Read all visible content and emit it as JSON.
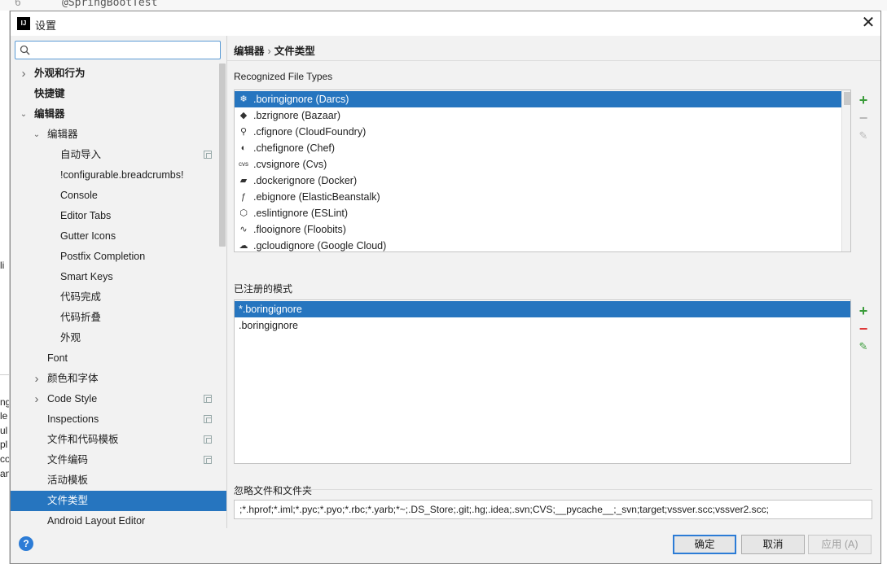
{
  "background_editor": {
    "line_number": "6",
    "code_line": "@SpringBootTest",
    "left_fragments": [
      "li",
      "ng",
      "le",
      "ul",
      "pl",
      "co",
      "an"
    ]
  },
  "window": {
    "title": "设置",
    "app_icon": "IJ"
  },
  "search": {
    "placeholder": "",
    "value": ""
  },
  "tree": [
    {
      "label": "外观和行为",
      "level": 0,
      "expand": "collapsed",
      "bold": true,
      "copy": false,
      "selected": false
    },
    {
      "label": "快捷键",
      "level": 0,
      "expand": "none",
      "bold": true,
      "copy": false,
      "selected": false
    },
    {
      "label": "编辑器",
      "level": 0,
      "expand": "expanded",
      "bold": true,
      "copy": false,
      "selected": false
    },
    {
      "label": "编辑器",
      "level": 1,
      "expand": "expanded",
      "bold": false,
      "copy": false,
      "selected": false
    },
    {
      "label": "自动导入",
      "level": 2,
      "expand": "none",
      "bold": false,
      "copy": true,
      "selected": false
    },
    {
      "label": "!configurable.breadcrumbs!",
      "level": 2,
      "expand": "none",
      "bold": false,
      "copy": false,
      "selected": false
    },
    {
      "label": "Console",
      "level": 2,
      "expand": "none",
      "bold": false,
      "copy": false,
      "selected": false
    },
    {
      "label": "Editor Tabs",
      "level": 2,
      "expand": "none",
      "bold": false,
      "copy": false,
      "selected": false
    },
    {
      "label": "Gutter Icons",
      "level": 2,
      "expand": "none",
      "bold": false,
      "copy": false,
      "selected": false
    },
    {
      "label": "Postfix Completion",
      "level": 2,
      "expand": "none",
      "bold": false,
      "copy": false,
      "selected": false
    },
    {
      "label": "Smart Keys",
      "level": 2,
      "expand": "none",
      "bold": false,
      "copy": false,
      "selected": false
    },
    {
      "label": "代码完成",
      "level": 2,
      "expand": "none",
      "bold": false,
      "copy": false,
      "selected": false
    },
    {
      "label": "代码折叠",
      "level": 2,
      "expand": "none",
      "bold": false,
      "copy": false,
      "selected": false
    },
    {
      "label": "外观",
      "level": 2,
      "expand": "none",
      "bold": false,
      "copy": false,
      "selected": false
    },
    {
      "label": "Font",
      "level": 1,
      "expand": "none",
      "bold": false,
      "copy": false,
      "selected": false
    },
    {
      "label": "颜色和字体",
      "level": 1,
      "expand": "collapsed",
      "bold": false,
      "copy": false,
      "selected": false
    },
    {
      "label": "Code Style",
      "level": 1,
      "expand": "collapsed",
      "bold": false,
      "copy": true,
      "selected": false
    },
    {
      "label": "Inspections",
      "level": 1,
      "expand": "none",
      "bold": false,
      "copy": true,
      "selected": false
    },
    {
      "label": "文件和代码模板",
      "level": 1,
      "expand": "none",
      "bold": false,
      "copy": true,
      "selected": false
    },
    {
      "label": "文件编码",
      "level": 1,
      "expand": "none",
      "bold": false,
      "copy": true,
      "selected": false
    },
    {
      "label": "活动模板",
      "level": 1,
      "expand": "none",
      "bold": false,
      "copy": false,
      "selected": false
    },
    {
      "label": "文件类型",
      "level": 1,
      "expand": "none",
      "bold": false,
      "copy": false,
      "selected": true
    },
    {
      "label": "Android Layout Editor",
      "level": 1,
      "expand": "none",
      "bold": false,
      "copy": false,
      "selected": false
    }
  ],
  "breadcrumb": {
    "parent": "编辑器",
    "separator": "›",
    "current": "文件类型"
  },
  "recognized": {
    "label": "Recognized File Types",
    "items": [
      {
        "text": ".boringignore (Darcs)",
        "icon": "darcs-icon",
        "glyph": "❄",
        "selected": true
      },
      {
        "text": ".bzrignore (Bazaar)",
        "icon": "bazaar-icon",
        "glyph": "◆",
        "selected": false
      },
      {
        "text": ".cfignore (CloudFoundry)",
        "icon": "cloudfoundry-icon",
        "glyph": "⚲",
        "selected": false
      },
      {
        "text": ".chefignore (Chef)",
        "icon": "chef-icon",
        "glyph": "◐",
        "selected": false
      },
      {
        "text": ".cvsignore (Cvs)",
        "icon": "cvs-icon",
        "glyph": "cvs",
        "selected": false
      },
      {
        "text": ".dockerignore (Docker)",
        "icon": "docker-icon",
        "glyph": "▰",
        "selected": false
      },
      {
        "text": ".ebignore (ElasticBeanstalk)",
        "icon": "elasticbeanstalk-icon",
        "glyph": "ƒ",
        "selected": false
      },
      {
        "text": ".eslintignore (ESLint)",
        "icon": "eslint-icon",
        "glyph": "⬡",
        "selected": false
      },
      {
        "text": ".flooignore (Floobits)",
        "icon": "floobits-icon",
        "glyph": "∿",
        "selected": false
      },
      {
        "text": ".gcloudignore (Google Cloud)",
        "icon": "googlecloud-icon",
        "glyph": "☁",
        "selected": false
      }
    ]
  },
  "patterns": {
    "label": "已注册的模式",
    "items": [
      {
        "text": "*.boringignore",
        "selected": true
      },
      {
        "text": ".boringignore",
        "selected": false
      }
    ]
  },
  "tool_glyphs": {
    "add": "+",
    "remove": "−",
    "edit": "✎"
  },
  "ignore": {
    "label": "忽略文件和文件夹",
    "value": ";*.hprof;*.iml;*.pyc;*.pyo;*.rbc;*.yarb;*~;.DS_Store;.git;.hg;.idea;.svn;CVS;__pycache__;_svn;target;vssver.scc;vssver2.scc;"
  },
  "buttons": {
    "help": "?",
    "ok": "确定",
    "cancel": "取消",
    "apply": "应用 (A)"
  },
  "colors": {
    "selection": "#2675bf",
    "add": "#3a9c3a",
    "remove": "#dd3333",
    "focus": "#2c7cd6"
  }
}
